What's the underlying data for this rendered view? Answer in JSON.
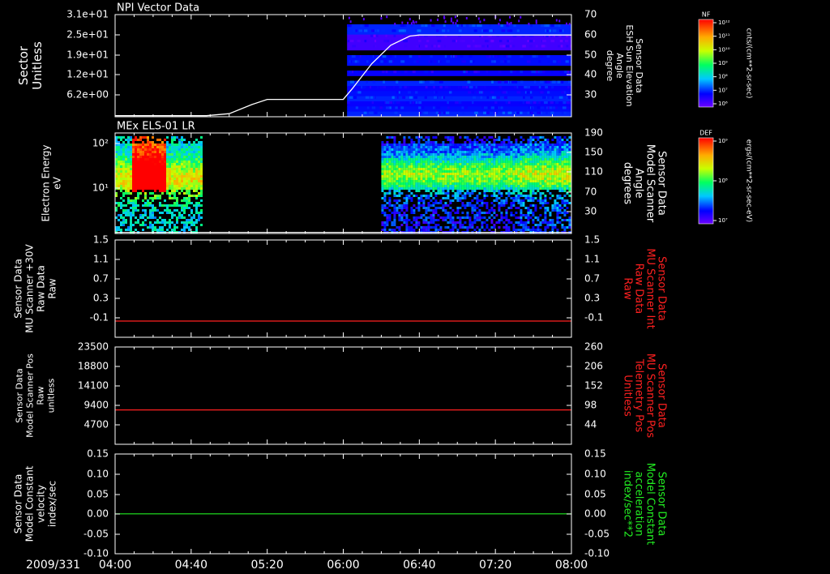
{
  "panels": [
    {
      "id": "p1",
      "title": "NPI Vector Data",
      "left_label": [
        "Sector",
        "Unitless"
      ],
      "left_ticks": [
        "3.1e+01",
        "2.5e+01",
        "1.9e+01",
        "1.2e+01",
        "6.2e+00"
      ],
      "right_label": [
        "Sensor Data",
        "ESH Sun Elevation",
        "Angle",
        "degree"
      ],
      "right_ticks": [
        "70",
        "60",
        "50",
        "40",
        "30"
      ],
      "right_label_color": "#ffffff"
    },
    {
      "id": "p2",
      "title": "MEx ELS-01 LR",
      "left_label": [
        "Electron Energy",
        "eV"
      ],
      "left_ticks": [
        "10²",
        "10¹"
      ],
      "right_label": [
        "Sensor Data",
        "Model Scanner",
        "Angle",
        "degrees"
      ],
      "right_ticks": [
        "190",
        "150",
        "110",
        "70",
        "30"
      ],
      "right_label_color": "#ffffff"
    },
    {
      "id": "p3",
      "title": "",
      "left_label": [
        "Sensor Data",
        "MU Scanner +30V",
        "Raw Data",
        "Raw"
      ],
      "left_ticks": [
        "1.5",
        "1.1",
        "0.7",
        "0.3",
        "-0.1"
      ],
      "right_label": [
        "Sensor Data",
        "MU Scanner Int",
        "Raw Data",
        "Raw"
      ],
      "right_ticks": [
        "1.5",
        "1.1",
        "0.7",
        "0.3",
        "-0.1"
      ],
      "right_label_color": "#ff2020"
    },
    {
      "id": "p4",
      "title": "",
      "left_label": [
        "Sensor Data",
        "Model Scanner Pos",
        "Raw",
        "unitless"
      ],
      "left_ticks": [
        "23500",
        "18800",
        "14100",
        "9400",
        "4700"
      ],
      "right_label": [
        "Sensor Data",
        "MU Scanner Pos",
        "Telemetry Pos",
        "Unitless"
      ],
      "right_ticks": [
        "260",
        "206",
        "152",
        "98",
        "44"
      ],
      "right_label_color": "#ff2020"
    },
    {
      "id": "p5",
      "title": "",
      "left_label": [
        "Sensor Data",
        "Model Constant",
        "velocity",
        "index/sec"
      ],
      "left_ticks": [
        "0.15",
        "0.10",
        "0.05",
        "0.00",
        "-0.05",
        "-0.10"
      ],
      "right_label": [
        "Sensor Data",
        "Model Constant",
        "acceleration",
        "index/sec**2"
      ],
      "right_ticks": [
        "0.15",
        "0.10",
        "0.05",
        "0.00",
        "-0.05",
        "-0.10"
      ],
      "right_label_color": "#22ee22"
    }
  ],
  "x_axis": {
    "date_label": "2009/331",
    "ticks": [
      "04:00",
      "04:40",
      "05:20",
      "06:00",
      "06:40",
      "07:20",
      "08:00"
    ]
  },
  "colorbars": [
    {
      "title": "NF",
      "tick_labels": [
        "10¹²",
        "10¹¹",
        "10¹⁰",
        "10⁹",
        "10⁸",
        "10⁷",
        "10⁶"
      ],
      "units": "cnts/(cm**2-sr-sec)"
    },
    {
      "title": "DEF",
      "tick_labels": [
        "10⁹",
        "10⁸",
        "10⁷"
      ],
      "units": "ergs/(cm**2-sr-sec-eV)"
    }
  ],
  "colors": {
    "background": "#000000",
    "axis": "#ffffff",
    "line_red": "#ff2020",
    "line_green": "#22ee22",
    "line_white": "#ffffff"
  },
  "chart_data": [
    {
      "type": "heatmap",
      "title": "NPI Vector Data",
      "xlabel": "2009/331",
      "ylabel": "Sector Unitless",
      "x_range": [
        "04:00",
        "08:00"
      ],
      "ylim": [
        0,
        31
      ],
      "data_start": "06:02",
      "overlay_series": {
        "name": "Sensor Data ESH Sun Elevation Angle",
        "axis": "right",
        "ylim": [
          20,
          70
        ],
        "x": [
          "04:00",
          "04:48",
          "05:00",
          "05:12",
          "05:20",
          "05:30",
          "06:00",
          "06:05",
          "06:15",
          "06:25",
          "06:35",
          "06:40",
          "08:00"
        ],
        "y": [
          20.5,
          20.5,
          21.5,
          26,
          28.5,
          28.5,
          28.5,
          34,
          46,
          55,
          59.5,
          60,
          60
        ]
      }
    },
    {
      "type": "heatmap",
      "title": "MEx ELS-01 LR",
      "ylabel": "Electron Energy eV",
      "yscale": "log",
      "data_intervals": [
        [
          "04:00",
          "04:45"
        ],
        [
          "06:20",
          "08:00"
        ]
      ],
      "overlay_series": {
        "name": "Sensor Data Model Scanner Angle",
        "axis": "right",
        "ylim": [
          10,
          190
        ],
        "x": [
          "04:00",
          "08:00"
        ],
        "y": [
          12,
          12
        ]
      }
    },
    {
      "type": "line",
      "ylim": [
        -0.3,
        1.5
      ],
      "series": [
        {
          "x": [
            "04:00",
            "08:00"
          ],
          "y": [
            0,
            0
          ]
        }
      ]
    },
    {
      "type": "line",
      "ylim": [
        0,
        23500
      ],
      "series": [
        {
          "x": [
            "04:00",
            "08:00"
          ],
          "y": [
            8300,
            8300
          ]
        }
      ]
    },
    {
      "type": "line",
      "ylim": [
        -0.1,
        0.15
      ],
      "series": [
        {
          "x": [
            "04:00",
            "08:00"
          ],
          "y": [
            0,
            0
          ]
        }
      ]
    }
  ]
}
